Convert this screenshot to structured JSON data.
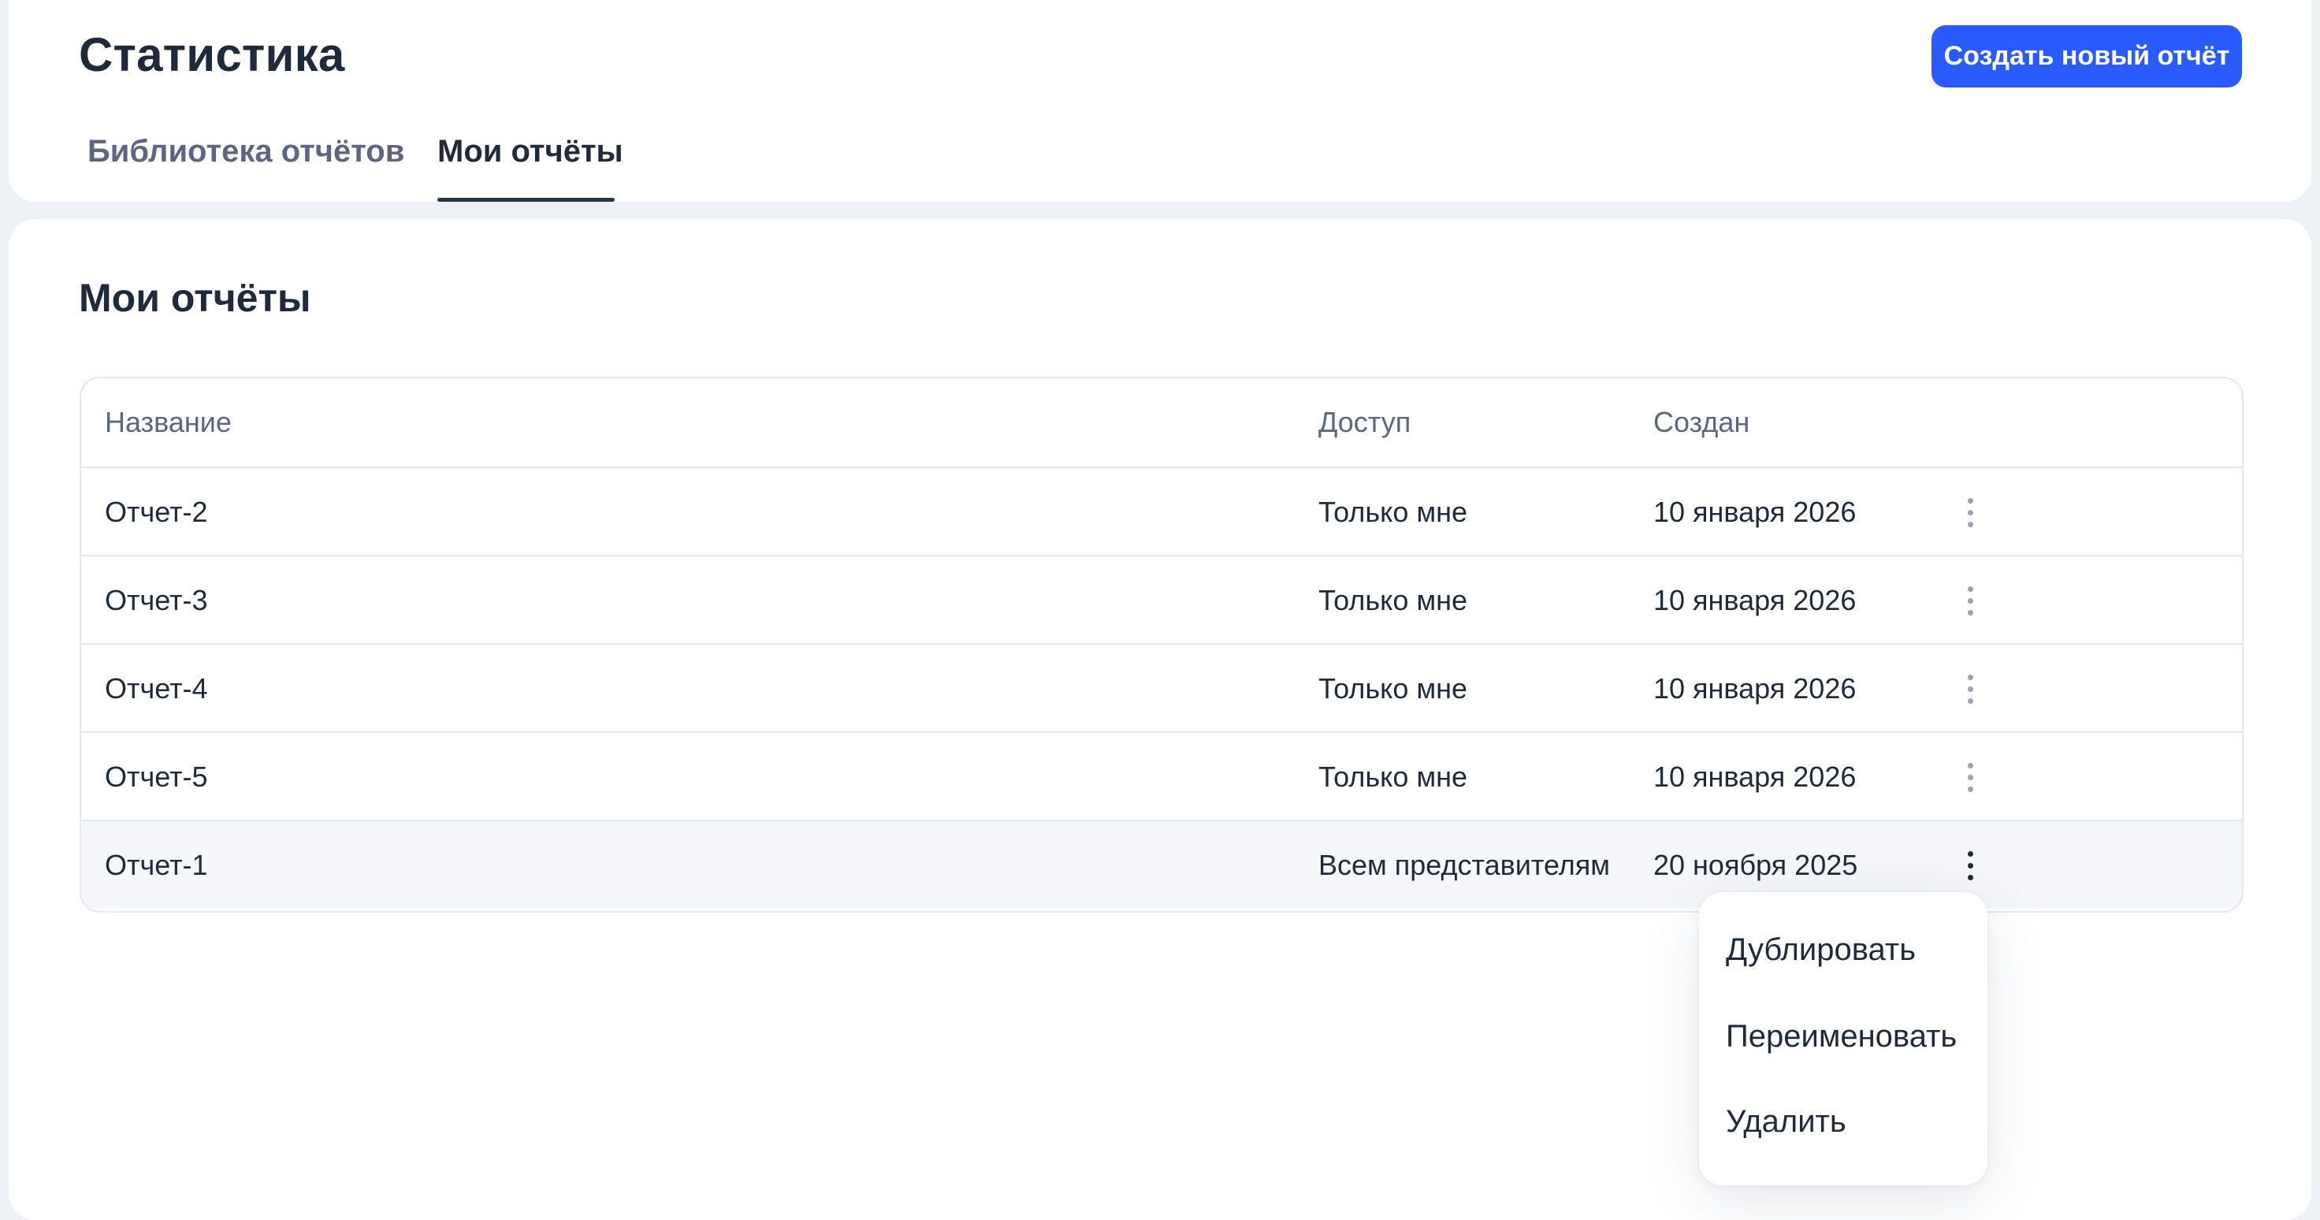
{
  "header": {
    "title": "Статистика",
    "create_button": "Создать новый отчёт",
    "tabs": [
      {
        "label": "Библиотека отчётов",
        "active": false
      },
      {
        "label": "Мои отчёты",
        "active": true
      }
    ]
  },
  "main": {
    "section_title": "Мои отчёты",
    "table": {
      "columns": [
        "Название",
        "Доступ",
        "Создан"
      ],
      "rows": [
        {
          "name": "Отчет-2",
          "access": "Только мне",
          "created": "10 января 2026"
        },
        {
          "name": "Отчет-3",
          "access": "Только мне",
          "created": "10 января 2026"
        },
        {
          "name": "Отчет-4",
          "access": "Только мне",
          "created": "10 января 2026"
        },
        {
          "name": "Отчет-5",
          "access": "Только мне",
          "created": "10 января 2026"
        },
        {
          "name": "Отчет-1",
          "access": "Всем представителям",
          "created": "20 ноября 2025"
        }
      ]
    },
    "row_menu": {
      "items": [
        "Дублировать",
        "Переименовать",
        "Удалить"
      ]
    }
  },
  "colors": {
    "accent": "#2A5BFF",
    "background": "#EEF1F6",
    "text": "#1F2A3A",
    "muted": "#5C6680"
  },
  "icons": {
    "row_menu_icon": "kebab-vertical-icon"
  }
}
